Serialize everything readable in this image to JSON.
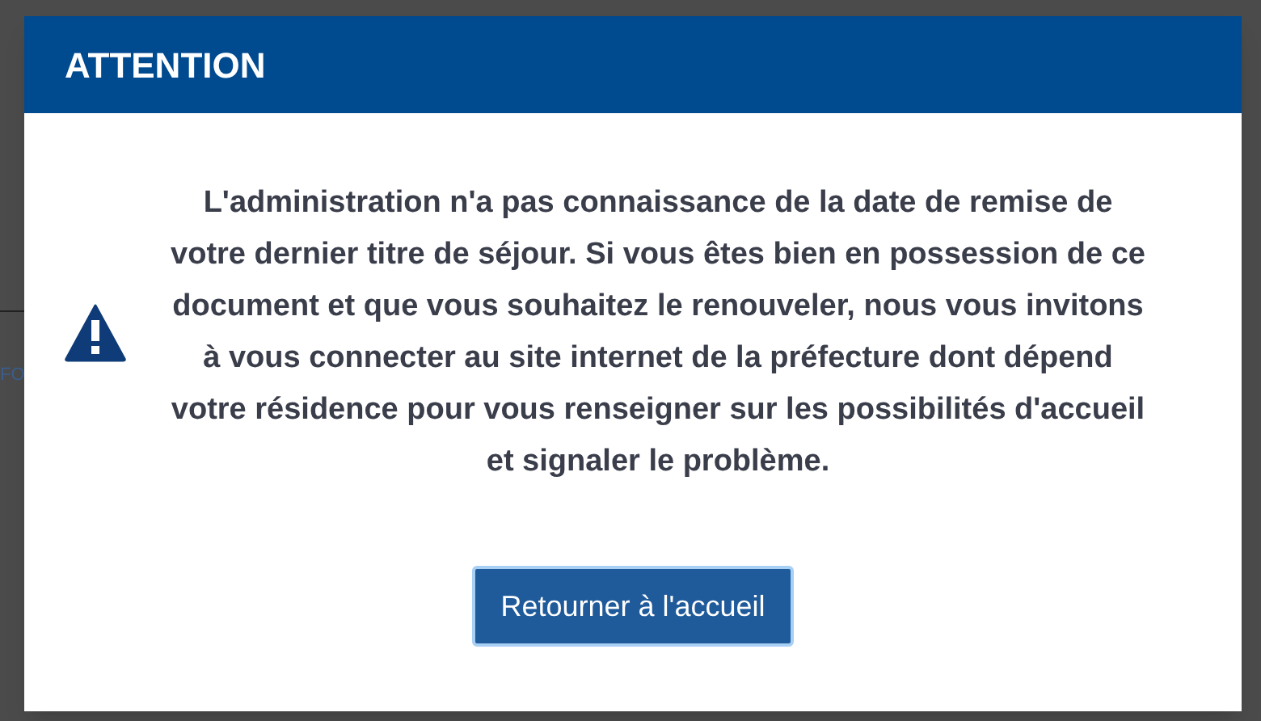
{
  "background": {
    "link": "FO"
  },
  "dialog": {
    "title": "ATTENTION",
    "message": "L'administration n'a pas connaissance de la date de remise de votre dernier titre de séjour. Si vous êtes bien en possession de ce document et que vous souhaitez le renouveler, nous vous invitons à vous connecter au site internet de la préfecture dont dépend votre résidence pour vous renseigner sur les possibilités d'accueil et signaler le problème.",
    "button": "Retourner à l'accueil"
  }
}
